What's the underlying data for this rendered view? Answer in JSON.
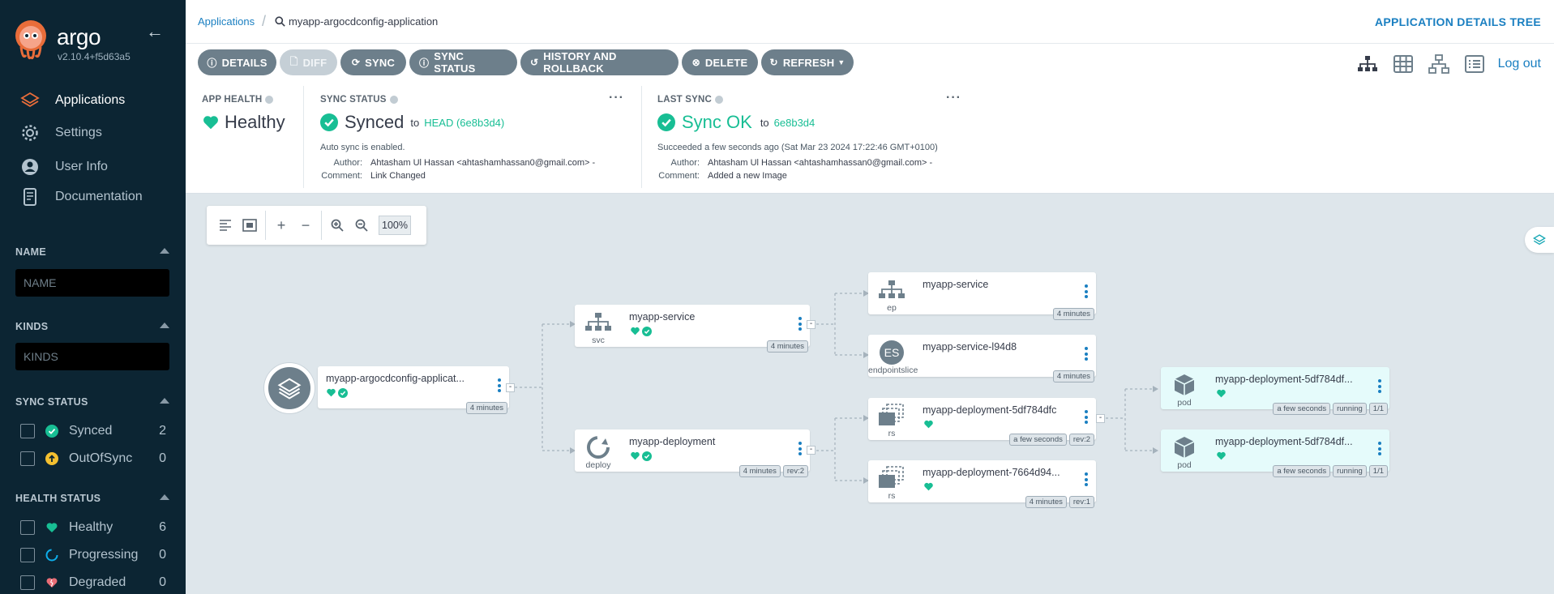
{
  "sidebar": {
    "brand": "argo",
    "version": "v2.10.4+f5d63a5",
    "nav": [
      {
        "label": "Applications"
      },
      {
        "label": "Settings"
      },
      {
        "label": "User Info"
      },
      {
        "label": "Documentation"
      }
    ],
    "name_filter": {
      "title": "NAME",
      "placeholder": "NAME"
    },
    "kinds_filter": {
      "title": "KINDS",
      "placeholder": "KINDS"
    },
    "sync_status": {
      "title": "SYNC STATUS",
      "items": [
        {
          "label": "Synced",
          "count": "2"
        },
        {
          "label": "OutOfSync",
          "count": "0"
        }
      ]
    },
    "health_status": {
      "title": "HEALTH STATUS",
      "items": [
        {
          "label": "Healthy",
          "count": "6"
        },
        {
          "label": "Progressing",
          "count": "0"
        },
        {
          "label": "Degraded",
          "count": "0"
        }
      ]
    }
  },
  "topbar": {
    "breadcrumb_root": "Applications",
    "breadcrumb_current": "myapp-argocdconfig-application",
    "title": "APPLICATION DETAILS TREE"
  },
  "toolbar": {
    "details": "DETAILS",
    "diff": "DIFF",
    "sync": "SYNC",
    "sync_status": "SYNC STATUS",
    "history": "HISTORY AND ROLLBACK",
    "delete": "DELETE",
    "refresh": "REFRESH",
    "logout": "Log out"
  },
  "status": {
    "app_health": {
      "label": "APP HEALTH",
      "value": "Healthy"
    },
    "sync_status": {
      "label": "SYNC STATUS",
      "value": "Synced",
      "to_text": "to",
      "revision": "HEAD (6e8b3d4)",
      "note": "Auto sync is enabled.",
      "author_key": "Author:",
      "author": "Ahtasham Ul Hassan <ahtashamhassan0@gmail.com> -",
      "comment_key": "Comment:",
      "comment": "Link Changed"
    },
    "last_sync": {
      "label": "LAST SYNC",
      "value": "Sync OK",
      "to_text": "to",
      "revision": "6e8b3d4",
      "note": "Succeeded a few seconds ago (Sat Mar 23 2024 17:22:46 GMT+0100)",
      "author_key": "Author:",
      "author": "Ahtasham Ul Hassan <ahtashamhassan0@gmail.com> -",
      "comment_key": "Comment:",
      "comment": "Added a new Image"
    }
  },
  "graph": {
    "zoom": "100%",
    "nodes": {
      "app": {
        "name": "myapp-argocdconfig-applicat...",
        "tags": [
          "4 minutes"
        ]
      },
      "svc": {
        "name": "myapp-service",
        "kind": "svc",
        "tags": [
          "4 minutes"
        ]
      },
      "deploy": {
        "name": "myapp-deployment",
        "kind": "deploy",
        "tags": [
          "4 minutes",
          "rev:2"
        ]
      },
      "ep": {
        "name": "myapp-service",
        "kind": "ep",
        "tags": [
          "4 minutes"
        ]
      },
      "es": {
        "name": "myapp-service-l94d8",
        "kind": "endpointslice",
        "icon_text": "ES",
        "tags": [
          "4 minutes"
        ]
      },
      "rs1": {
        "name": "myapp-deployment-5df784dfc",
        "kind": "rs",
        "tags": [
          "a few seconds",
          "rev:2"
        ]
      },
      "rs2": {
        "name": "myapp-deployment-7664d94...",
        "kind": "rs",
        "tags": [
          "4 minutes",
          "rev:1"
        ]
      },
      "pod1": {
        "name": "myapp-deployment-5df784df...",
        "kind": "pod",
        "tags": [
          "a few seconds",
          "running",
          "1/1"
        ]
      },
      "pod2": {
        "name": "myapp-deployment-5df784df...",
        "kind": "pod",
        "tags": [
          "a few seconds",
          "running",
          "1/1"
        ]
      }
    }
  },
  "colors": {
    "sidebar_bg": "#0c2533",
    "accent_blue": "#1a7fc1",
    "healthy_green": "#18be94",
    "button_gray": "#6d7f8b",
    "pod_bg": "#e5fbfb",
    "degraded_red": "#e96d76",
    "outofsync_yellow": "#f4c030"
  },
  "icons": [
    "argo-logo",
    "collapse-arrow-icon",
    "layers-icon",
    "gear-icon",
    "user-icon",
    "docs-icon",
    "heart-icon",
    "check-circle-icon",
    "search-icon",
    "tree-view-icon",
    "grid-view-icon",
    "network-view-icon",
    "list-view-icon"
  ]
}
